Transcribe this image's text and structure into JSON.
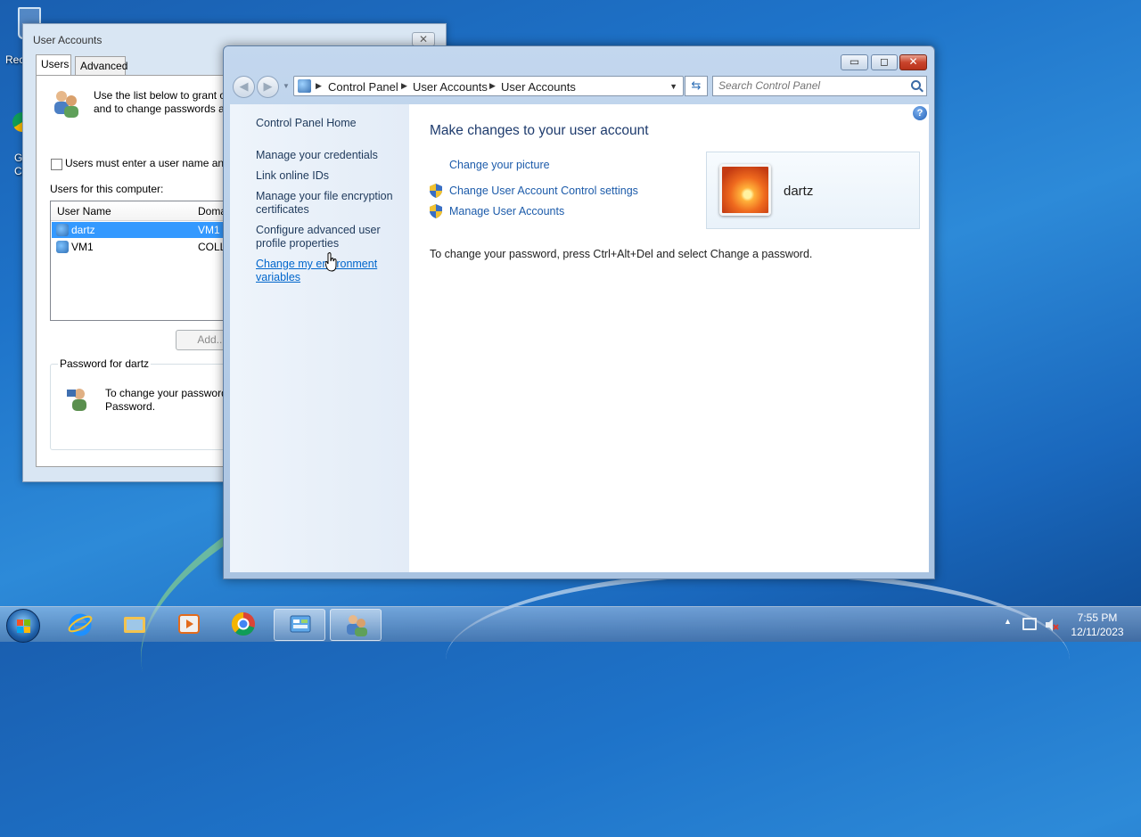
{
  "desktop": {
    "recycle_bin_label": "Rec",
    "chrome_label_line1": "G",
    "chrome_label_line2": "Cl"
  },
  "user_accounts_dialog": {
    "title": "User Accounts",
    "close_glyph": "✕",
    "tabs": [
      {
        "label": "Users",
        "active": true
      },
      {
        "label": "Advanced",
        "active": false
      }
    ],
    "intro_line1": "Use the list below to grant o",
    "intro_line2": "and to change passwords ar",
    "checkbox_label": "Users must enter a user name and",
    "users_label": "Users for this computer:",
    "columns": [
      "User Name",
      "Doma"
    ],
    "rows": [
      {
        "name": "dartz",
        "domain": "VM1",
        "selected": true
      },
      {
        "name": "VM1",
        "domain": "COLL",
        "selected": false
      }
    ],
    "add_button": "Add...",
    "password_group_label": "Password for dartz",
    "password_line1": "To change your password",
    "password_line2": "Password."
  },
  "control_panel": {
    "window_buttons": {
      "minimize": "▭",
      "maximize": "◻",
      "close": "✕"
    },
    "breadcrumb": [
      "Control Panel",
      "User Accounts",
      "User Accounts"
    ],
    "search_placeholder": "Search Control Panel",
    "sidebar": [
      {
        "label": "Control Panel Home"
      },
      {
        "label": "Manage your credentials"
      },
      {
        "label": "Link online IDs"
      },
      {
        "label": "Manage your file encryption certificates"
      },
      {
        "label": "Configure advanced user profile properties"
      },
      {
        "label": "Change my environment variables"
      }
    ],
    "main_title": "Make changes to your user account",
    "tasks": [
      {
        "label": "Change your picture",
        "icon": null
      },
      {
        "label": "Change User Account Control settings",
        "icon": "shield-icon"
      },
      {
        "label": "Manage User Accounts",
        "icon": "shield-icon"
      }
    ],
    "info_text": "To change your password, press Ctrl+Alt+Del and select Change a password.",
    "user_name": "dartz",
    "help_glyph": "?"
  },
  "taskbar": {
    "apps": [
      "internet-explorer",
      "file-explorer",
      "media-player",
      "chrome",
      "control-panel",
      "user-accounts"
    ],
    "time": "7:55 PM",
    "date": "12/11/2023"
  },
  "colors": {
    "link": "#1c5baa",
    "title": "#1e3b6d",
    "selection": "#3399ff",
    "close_red": "#c9442c"
  }
}
